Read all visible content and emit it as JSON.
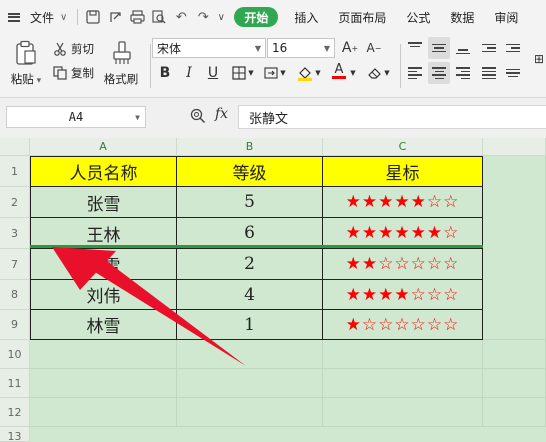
{
  "menu": {
    "file": "文件",
    "tabs": [
      "开始",
      "插入",
      "页面布局",
      "公式",
      "数据",
      "审阅"
    ]
  },
  "ribbon": {
    "paste": "粘贴",
    "cut": "剪切",
    "copy": "复制",
    "format_painter": "格式刷",
    "font_name": "宋体",
    "font_size": "16"
  },
  "formula_bar": {
    "name_box": "A4",
    "fx": "fx",
    "value": "张静文"
  },
  "columns": [
    "A",
    "B",
    "C"
  ],
  "rows": [
    {
      "num": "1",
      "cells": [
        "人员名称",
        "等级",
        "星标"
      ],
      "header": true
    },
    {
      "num": "2",
      "cells": [
        "张雪",
        "5",
        "★★★★★☆☆"
      ]
    },
    {
      "num": "3",
      "cells": [
        "王林",
        "6",
        "★★★★★★☆"
      ]
    },
    {
      "num": "7",
      "cells": [
        "吴雪",
        "2",
        "★★☆☆☆☆☆"
      ]
    },
    {
      "num": "8",
      "cells": [
        "刘伟",
        "4",
        "★★★★☆☆☆"
      ]
    },
    {
      "num": "9",
      "cells": [
        "林雪",
        "1",
        "★☆☆☆☆☆☆"
      ]
    }
  ],
  "empty_rows": [
    "10",
    "11",
    "12",
    "13"
  ],
  "colors": {
    "accent": "#2fa84f",
    "header_fill": "#ffff00",
    "star": "#ff0000",
    "sheet_bg": "#cfe8cf",
    "annotation_arrow": "#e8102a"
  }
}
